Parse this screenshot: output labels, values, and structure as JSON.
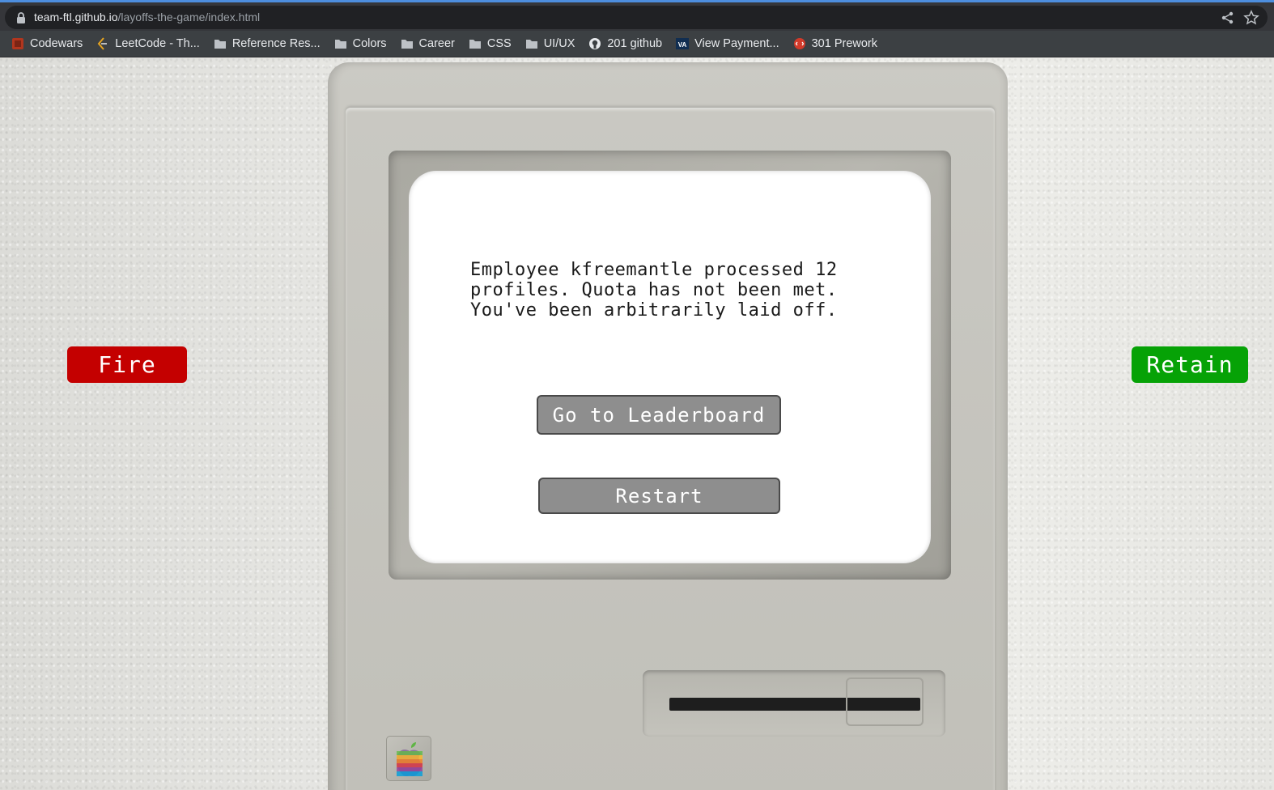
{
  "browser": {
    "url_host": "team-ftl.github.io",
    "url_path": "/layoffs-the-game/index.html",
    "bookmarks": [
      {
        "label": "Codewars",
        "icon": "codewars-icon"
      },
      {
        "label": "LeetCode - Th...",
        "icon": "leetcode-icon"
      },
      {
        "label": "Reference Res...",
        "icon": "folder-icon"
      },
      {
        "label": "Colors",
        "icon": "folder-icon"
      },
      {
        "label": "Career",
        "icon": "folder-icon"
      },
      {
        "label": "CSS",
        "icon": "folder-icon"
      },
      {
        "label": "UI/UX",
        "icon": "folder-icon"
      },
      {
        "label": "201 github",
        "icon": "github-icon"
      },
      {
        "label": "View Payment...",
        "icon": "va-icon"
      },
      {
        "label": "301 Prework",
        "icon": "prework-icon"
      }
    ]
  },
  "game": {
    "message": "Employee kfreemantle processed 12\nprofiles. Quota has not been met.\nYou've been arbitrarily laid off.",
    "leaderboard_label": "Go to Leaderboard",
    "restart_label": "Restart",
    "fire_label": "Fire",
    "retain_label": "Retain"
  },
  "colors": {
    "fire": "#c40000",
    "retain": "#06a206",
    "screen_button": "#8e8e8e"
  }
}
